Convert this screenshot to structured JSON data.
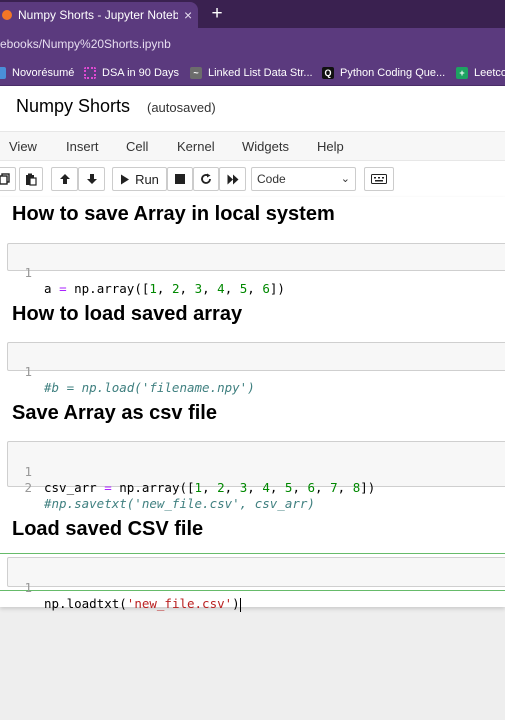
{
  "browser": {
    "tab_title": "Numpy Shorts - Jupyter Notebook",
    "tab_close": "×",
    "new_tab": "+",
    "url": "ebooks/Numpy%20Shorts.ipynb",
    "bookmarks": [
      {
        "label": "Novorésumé"
      },
      {
        "label": "DSA in 90 Days"
      },
      {
        "label": "Linked List Data Str..."
      },
      {
        "label": "Python Coding Que..."
      },
      {
        "label": "Leetco"
      }
    ]
  },
  "notebook": {
    "title": "Numpy Shorts",
    "autosave": "(autosaved)"
  },
  "menu": [
    "View",
    "Insert",
    "Cell",
    "Kernel",
    "Widgets",
    "Help"
  ],
  "toolbar": {
    "run_label": "Run",
    "cell_type": "Code"
  },
  "cells": {
    "h1": "How to save Array in local system",
    "c1_ln1": "1",
    "h2": "How to load saved array",
    "c2_ln1": "1",
    "c2_code": "#b = np.load('filename.npy')",
    "h3": "Save Array as csv file",
    "c3_ln1": "1",
    "c3_ln2": "2",
    "c3_code2": "#np.savetxt('new_file.csv', csv_arr)",
    "h4": "Load saved CSV file",
    "c4_ln1": "1"
  },
  "colors": {
    "browser_purple": "#5b3a7e",
    "tabstrip": "#3a2150",
    "selected_cell_border": "#66bb6a"
  }
}
